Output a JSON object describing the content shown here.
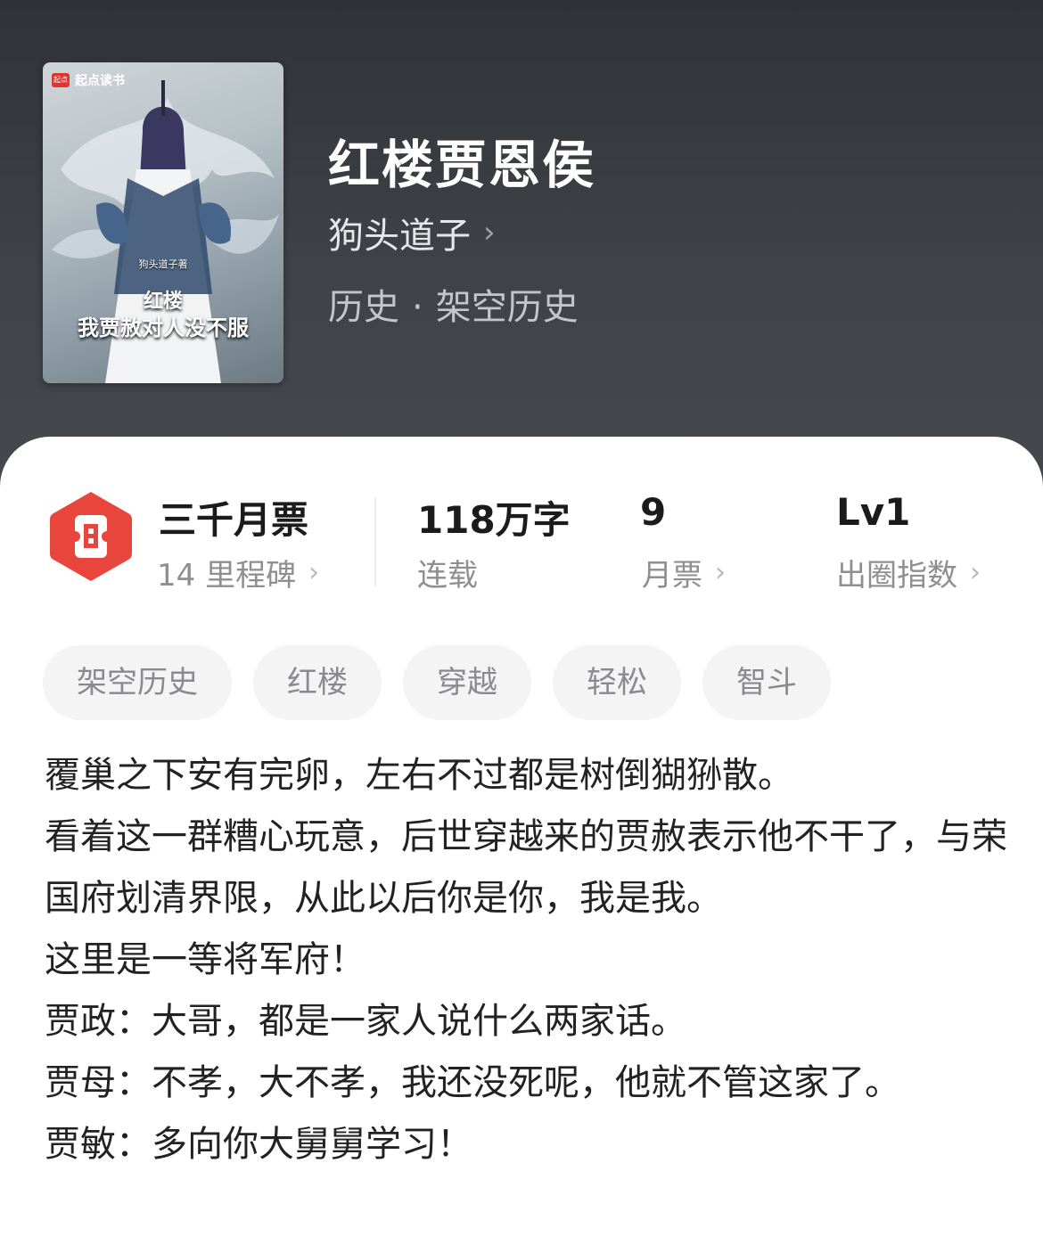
{
  "cover": {
    "logo_text": "起点读书",
    "logo_mark": "起点",
    "author": "狗头道子著",
    "title_line1": "红楼",
    "title_line2": "我贾赦对人没不服"
  },
  "book": {
    "title": "红楼贾恩侯",
    "author": "狗头道子",
    "genre_main": "历史",
    "genre_dot": "·",
    "genre_sub": "架空历史"
  },
  "stats": {
    "badge_title": "三千月票",
    "badge_sub": "14 里程碑",
    "words_value": "118万字",
    "words_label": "连载",
    "tickets_value": "9",
    "tickets_label": "月票",
    "level_value": "Lv1",
    "level_label": "出圈指数",
    "chevron": "›",
    "accent": "#e8453c"
  },
  "tags": [
    "架空历史",
    "红楼",
    "穿越",
    "轻松",
    "智斗"
  ],
  "description": [
    "覆巢之下安有完卵，左右不过都是树倒猢狲散。",
    "看着这一群糟心玩意，后世穿越来的贾赦表示他不干了，与荣国府划清界限，从此以后你是你，我是我。",
    "这里是一等将军府！",
    "贾政：大哥，都是一家人说什么两家话。",
    "贾母：不孝，大不孝，我还没死呢，他就不管这家了。",
    "贾敏：多向你大舅舅学习！"
  ]
}
